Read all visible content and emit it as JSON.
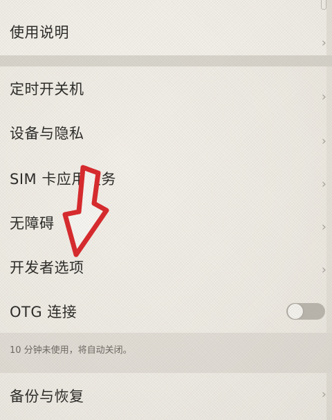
{
  "settings": {
    "items": [
      {
        "id": "usage",
        "label": "使用说明"
      },
      {
        "id": "schedule",
        "label": "定时开关机"
      },
      {
        "id": "privacy",
        "label": "设备与隐私"
      },
      {
        "id": "sim",
        "label": "SIM 卡应用服务"
      },
      {
        "id": "accessibility",
        "label": "无障碍"
      },
      {
        "id": "developer",
        "label": "开发者选项"
      },
      {
        "id": "otg",
        "label": "OTG 连接",
        "toggle_on": false
      },
      {
        "id": "backup",
        "label": "备份与恢复"
      }
    ],
    "otg_hint": "10 分钟未使用，将自动关闭。"
  },
  "colors": {
    "background": "#e6e2da",
    "text": "#2b2a27",
    "hint_text": "#6c6962",
    "arrow_fill": "#f6f4f0",
    "arrow_stroke": "#d8282c"
  },
  "icons": {
    "chevron": "chevron-right-icon",
    "annotation": "red-arrow-icon"
  }
}
